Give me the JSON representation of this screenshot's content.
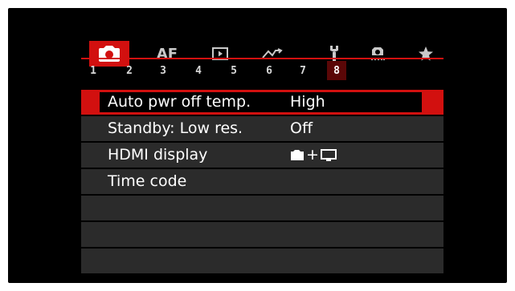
{
  "tabs": [
    {
      "id": "shooting",
      "label": "",
      "icon": "camera-icon",
      "active": true
    },
    {
      "id": "af",
      "label": "AF",
      "icon": "",
      "active": false
    },
    {
      "id": "playback",
      "label": "",
      "icon": "playback-icon",
      "active": false
    },
    {
      "id": "wireless",
      "label": "",
      "icon": "wireless-icon",
      "active": false
    },
    {
      "id": "setup",
      "label": "",
      "icon": "wrench-icon",
      "active": false
    },
    {
      "id": "custom",
      "label": "",
      "icon": "custom-functions-icon",
      "active": false
    },
    {
      "id": "mymenu",
      "label": "",
      "icon": "star-icon",
      "active": false
    }
  ],
  "pages": [
    "1",
    "2",
    "3",
    "4",
    "5",
    "6",
    "7",
    "8"
  ],
  "active_page": "8",
  "menu": [
    {
      "label": "Auto pwr off temp.",
      "value": "High"
    },
    {
      "label": "Standby: Low res.",
      "value": "Off"
    },
    {
      "label": "HDMI display",
      "value": "+"
    },
    {
      "label": "Time code",
      "value": ""
    }
  ],
  "colors": {
    "accent": "#d2100f",
    "row": "#2b2b2b",
    "background": "#000000"
  }
}
